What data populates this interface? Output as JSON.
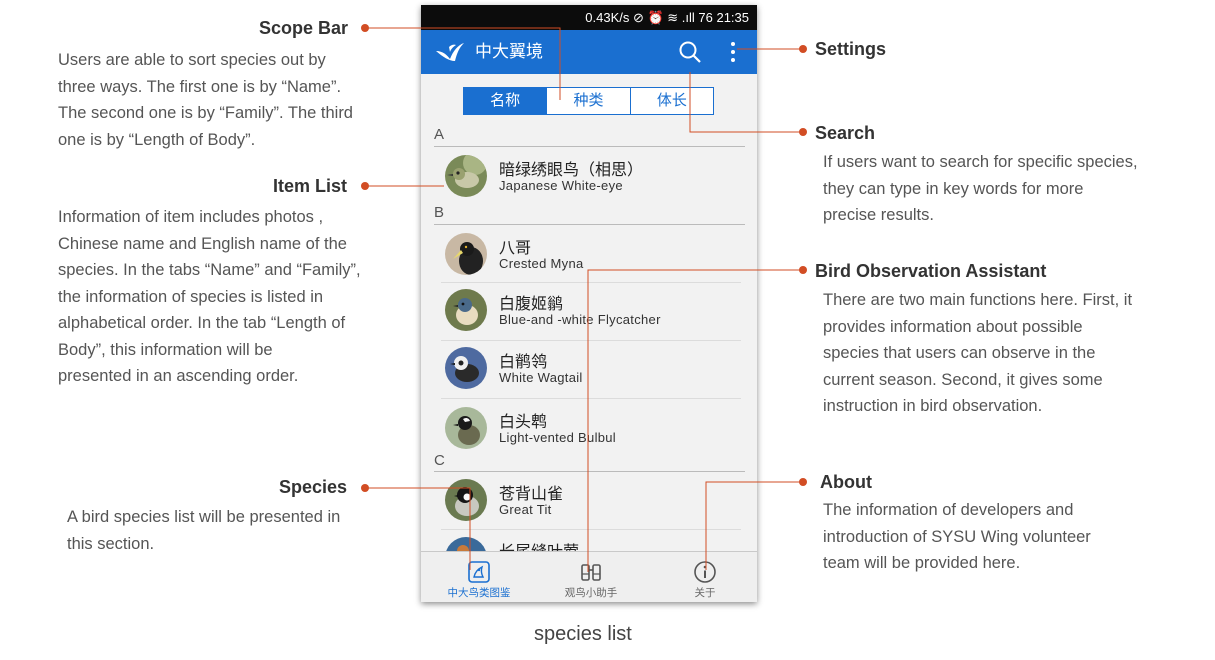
{
  "annotations": {
    "scope_bar": {
      "title": "Scope Bar",
      "text": [
        "Users are able to sort species out by",
        "three ways. The first one is by “Name”.",
        "The second one is by “Family”. The third",
        "one is by “Length of Body”."
      ]
    },
    "item_list": {
      "title": "Item List",
      "text": [
        "Information of item includes photos ,",
        "Chinese name and English name of the",
        "species. In the tabs “Name” and “Family”,",
        "the information of species is listed in",
        "alphabetical order. In the tab “Length of",
        "Body”, this information will be",
        "presented in an ascending order."
      ]
    },
    "species": {
      "title": "Species",
      "text": [
        "A bird species list will be presented  in",
        "this section."
      ]
    },
    "settings": {
      "title": "Settings"
    },
    "search": {
      "title": "Search",
      "text": [
        "If users want to search for specific species,",
        "they can type in key words for more",
        "precise results."
      ]
    },
    "bird_observation": {
      "title": "Bird Observation Assistant",
      "text": [
        "There are two main functions here. First, it",
        "provides information about possible",
        "species that users can observe in the",
        "current season. Second, it gives some",
        "instruction in bird observation."
      ]
    },
    "about": {
      "title": "About",
      "text": [
        "The information  of developers and",
        "introduction of SYSU Wing volunteer",
        "team will be provided here."
      ]
    }
  },
  "phone": {
    "status_bar": "0.43K/s  ⊘  ⏰  ≋  .ıll  76  21:35",
    "app_title": "中大翼境",
    "tabs": [
      "名称",
      "种类",
      "体长"
    ],
    "active_tab": "名称",
    "sections": {
      "A": "A",
      "B": "B",
      "C": "C"
    },
    "items": [
      {
        "cn": "暗绿绣眼鸟（相思）",
        "en": "Japanese White-eye"
      },
      {
        "cn": "八哥",
        "en": "Crested Myna"
      },
      {
        "cn": "白腹姬鹟",
        "en": "Blue-and -white Flycatcher"
      },
      {
        "cn": "白鹡鸰",
        "en": "White Wagtail"
      },
      {
        "cn": "白头鹎",
        "en": "Light-vented Bulbul"
      },
      {
        "cn": "苍背山雀",
        "en": "Great Tit"
      },
      {
        "cn": "长尾缝叶莺",
        "en": ""
      }
    ],
    "bottom_nav": [
      "中大鸟类图鉴",
      "观鸟小助手",
      "关于"
    ]
  },
  "caption": "species list",
  "colors": {
    "accent": "#d24d24",
    "brand": "#1a6fd0"
  }
}
